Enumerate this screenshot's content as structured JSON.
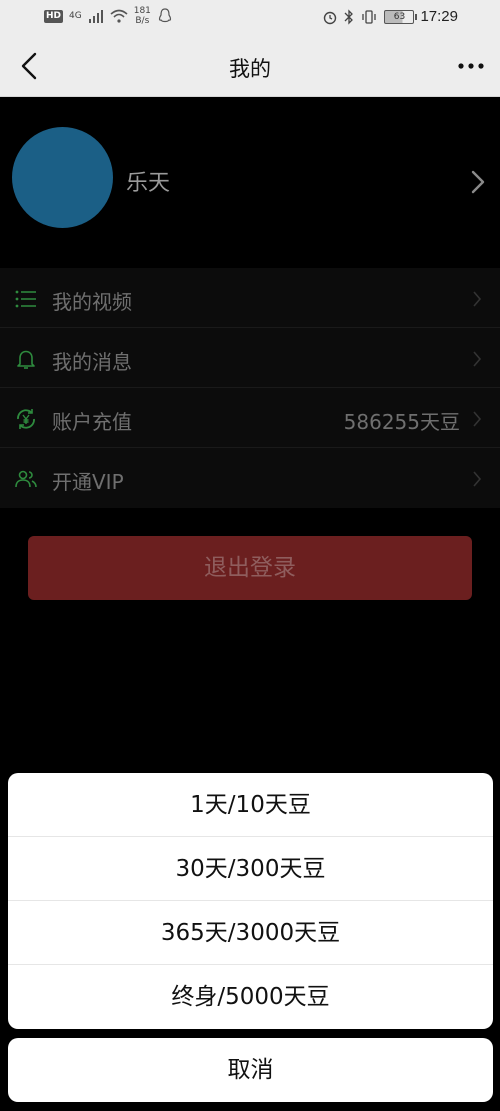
{
  "status_bar": {
    "hd": "HD",
    "network": "4G",
    "speed_value": "181",
    "speed_unit": "B/s",
    "battery": "63",
    "time": "17:29"
  },
  "nav": {
    "title": "我的"
  },
  "profile": {
    "username": "乐天",
    "avatar_color": "#1b5f86"
  },
  "menu": [
    {
      "label": "我的视频",
      "value": "",
      "icon": "list-icon"
    },
    {
      "label": "我的消息",
      "value": "",
      "icon": "bell-icon"
    },
    {
      "label": "账户充值",
      "value": "586255天豆",
      "icon": "yen-recharge-icon"
    },
    {
      "label": "开通VIP",
      "value": "",
      "icon": "users-icon"
    }
  ],
  "logout_label": "退出登录",
  "action_sheet": {
    "options": [
      "1天/10天豆",
      "30天/300天豆",
      "365天/3000天豆",
      "终身/5000天豆"
    ],
    "cancel": "取消"
  },
  "colors": {
    "accent_green": "#2e8b3e",
    "logout_red": "#6b1f1f",
    "background": "#000000"
  }
}
